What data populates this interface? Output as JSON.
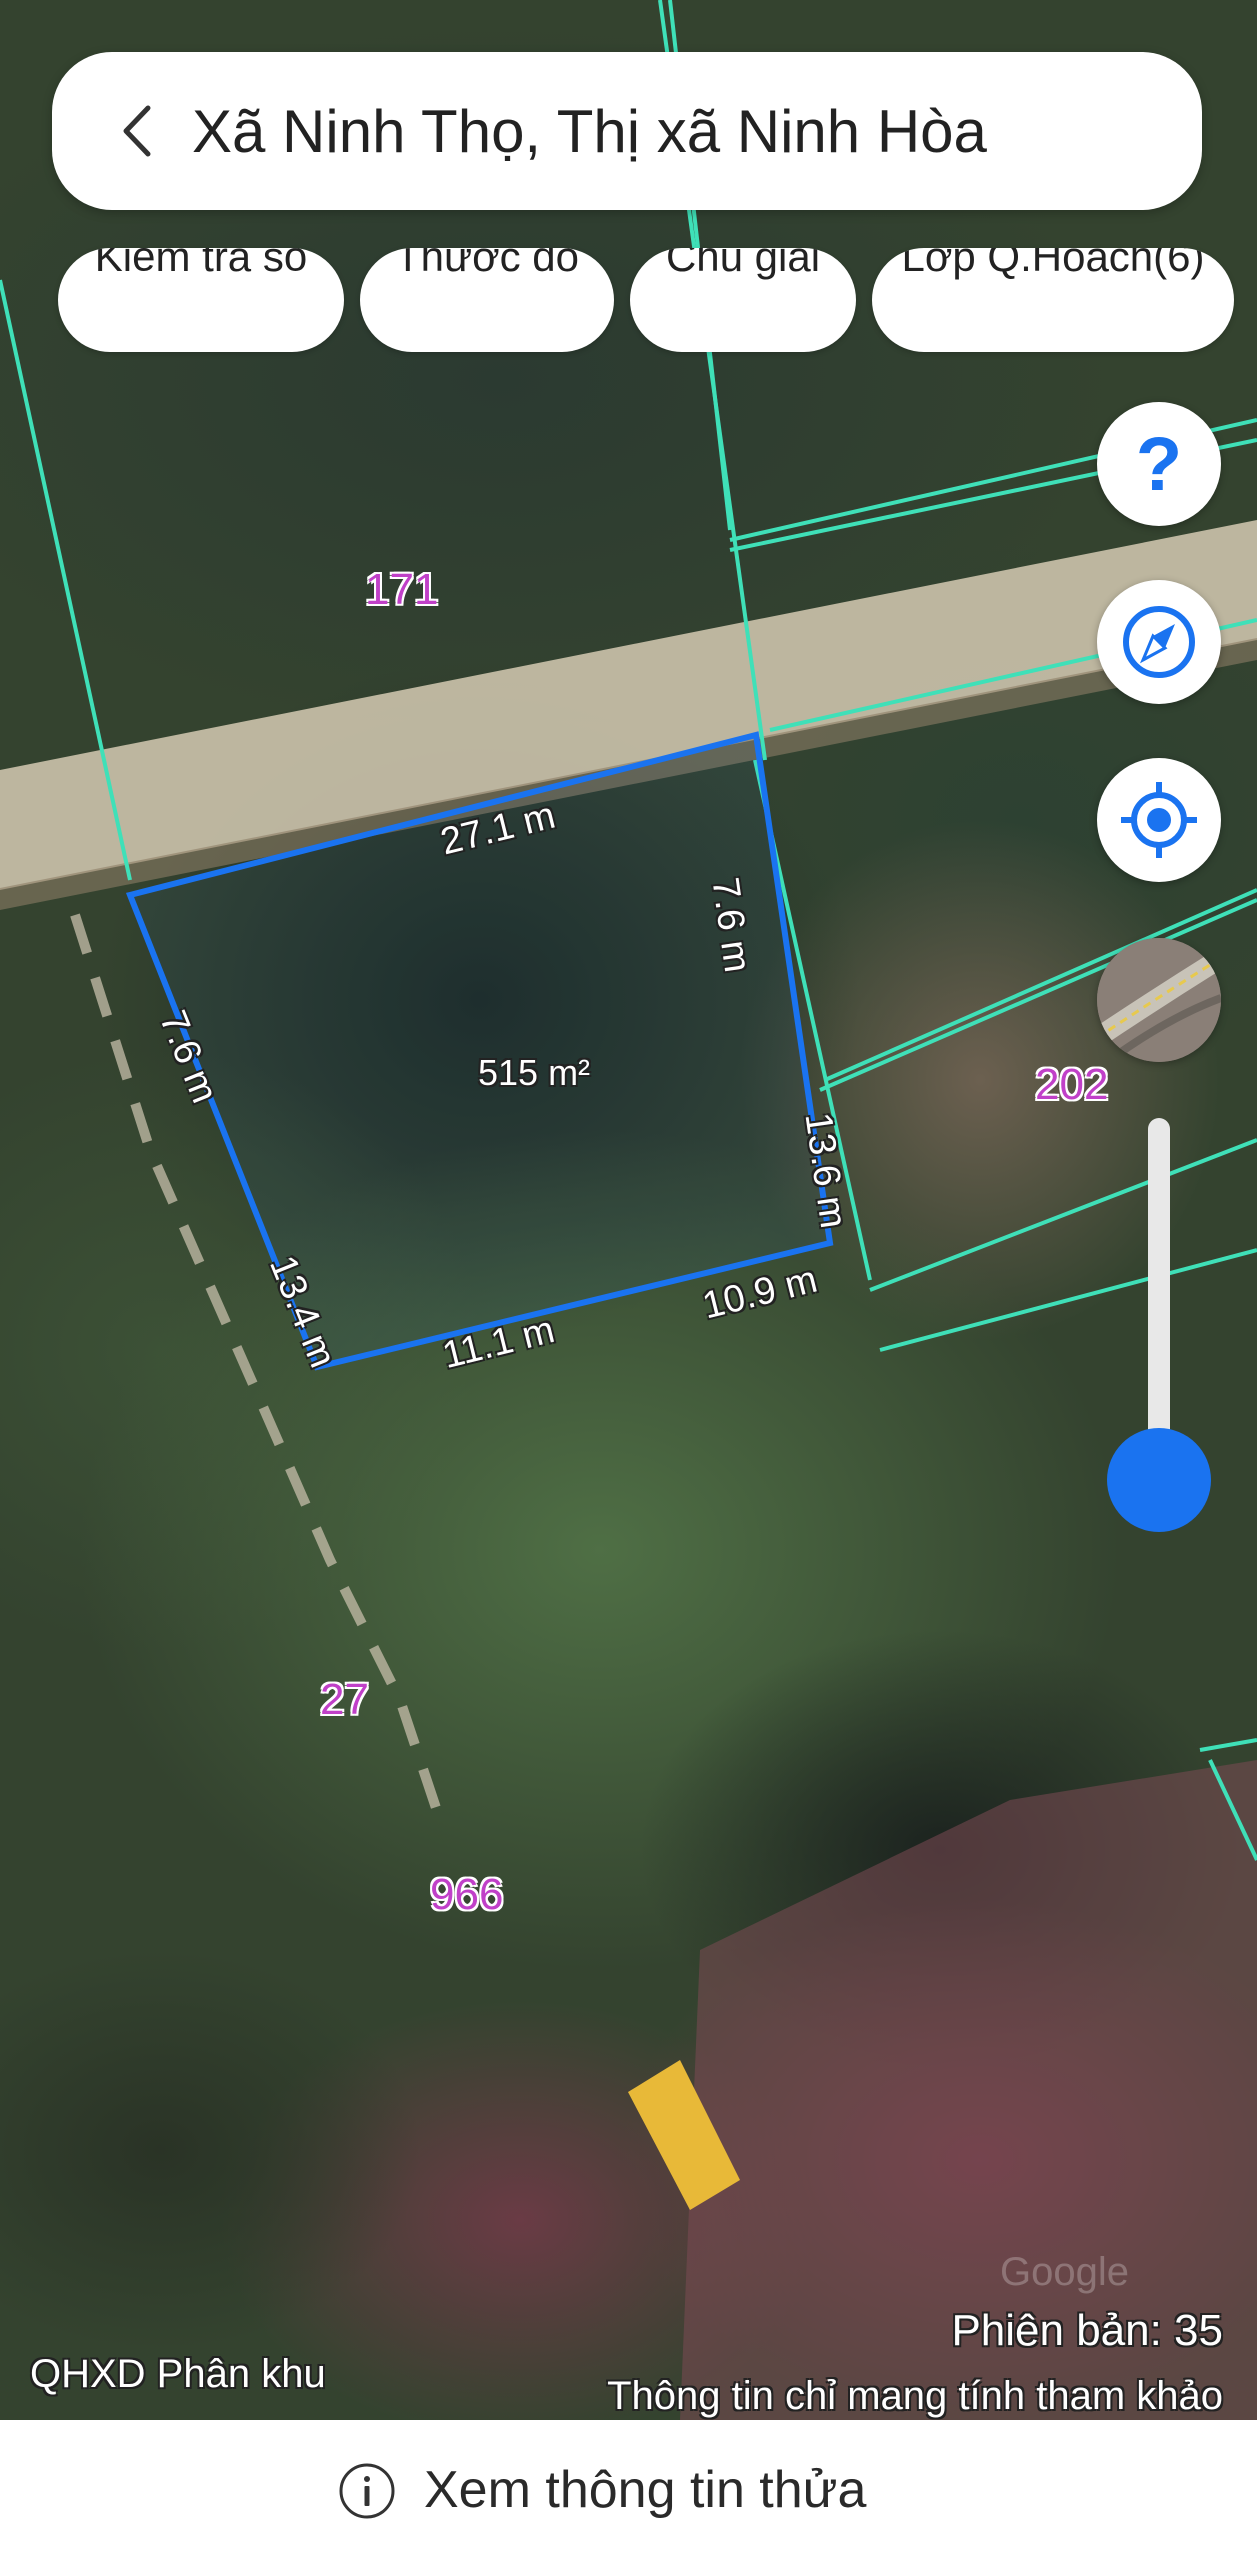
{
  "header": {
    "title": "Xã Ninh Thọ, Thị xã Ninh Hòa",
    "back_icon": "chevron-left-icon"
  },
  "chips": [
    {
      "label": "Kiểm tra sổ"
    },
    {
      "label": "Thước đo"
    },
    {
      "label": "Chú giải"
    },
    {
      "label": "Lớp Q.Hoach(6)"
    }
  ],
  "fabs": {
    "help_icon": "question-mark-icon",
    "compass_icon": "compass-icon",
    "location_icon": "my-location-icon",
    "layer_icon": "satellite-layer-icon"
  },
  "map": {
    "parcel_labels": [
      "171",
      "202",
      "27",
      "966"
    ],
    "parcel_area": "515 m²",
    "edge_lengths": [
      "27.1 m",
      "7.6 m",
      "13.6 m",
      "10.9 m",
      "11.1 m",
      "13.4 m",
      "7.6 m"
    ],
    "accent_color": "#1a73f0",
    "boundary_color": "#3fe0b8",
    "label_color": "#c040c8",
    "watermark": "Google"
  },
  "footer_overlay": {
    "version": "Phiên bản: 35",
    "disclaimer": "Thông tin chỉ mang tính tham khảo",
    "layer_name": "QHXD Phân khu"
  },
  "bottom_bar": {
    "label": "Xem thông tin thửa",
    "icon": "info-icon"
  }
}
